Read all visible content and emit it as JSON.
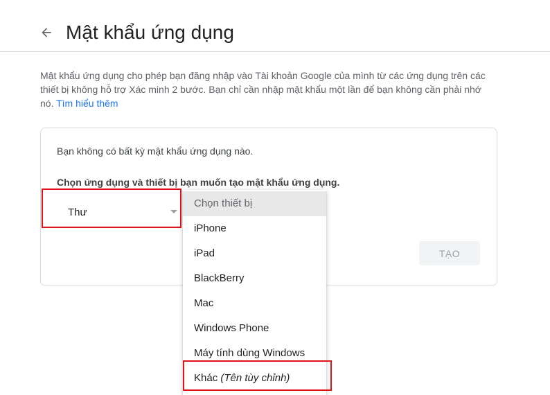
{
  "header": {
    "back_icon": "arrow-left-icon",
    "title": "Mật khẩu ứng dụng"
  },
  "description": {
    "text": "Mật khẩu ứng dụng cho phép bạn đăng nhập vào Tài khoản Google của mình từ các ứng dụng trên các thiết bị không hỗ trợ Xác minh 2 bước. Bạn chỉ cần nhập mật khẩu một lần để bạn không cần phải nhớ nó. ",
    "link": "Tìm hiểu thêm"
  },
  "card": {
    "no_passwords": "Bạn không có bất kỳ mật khẩu ứng dụng nào.",
    "choose_label": "Chọn ứng dụng và thiết bị bạn muốn tạo mật khẩu ứng dụng.",
    "app_select": {
      "value": "Thư"
    },
    "create_button": "TẠO"
  },
  "device_dropdown": {
    "placeholder": "Chọn thiết bị",
    "options": [
      "iPhone",
      "iPad",
      "BlackBerry",
      "Mac",
      "Windows Phone",
      "Máy tính dùng Windows"
    ],
    "other": {
      "label": "Khác",
      "hint": "(Tên tùy chỉnh)"
    }
  },
  "colors": {
    "highlight": "#e0131a",
    "link": "#1a73e8",
    "divider": "#dadce0"
  }
}
